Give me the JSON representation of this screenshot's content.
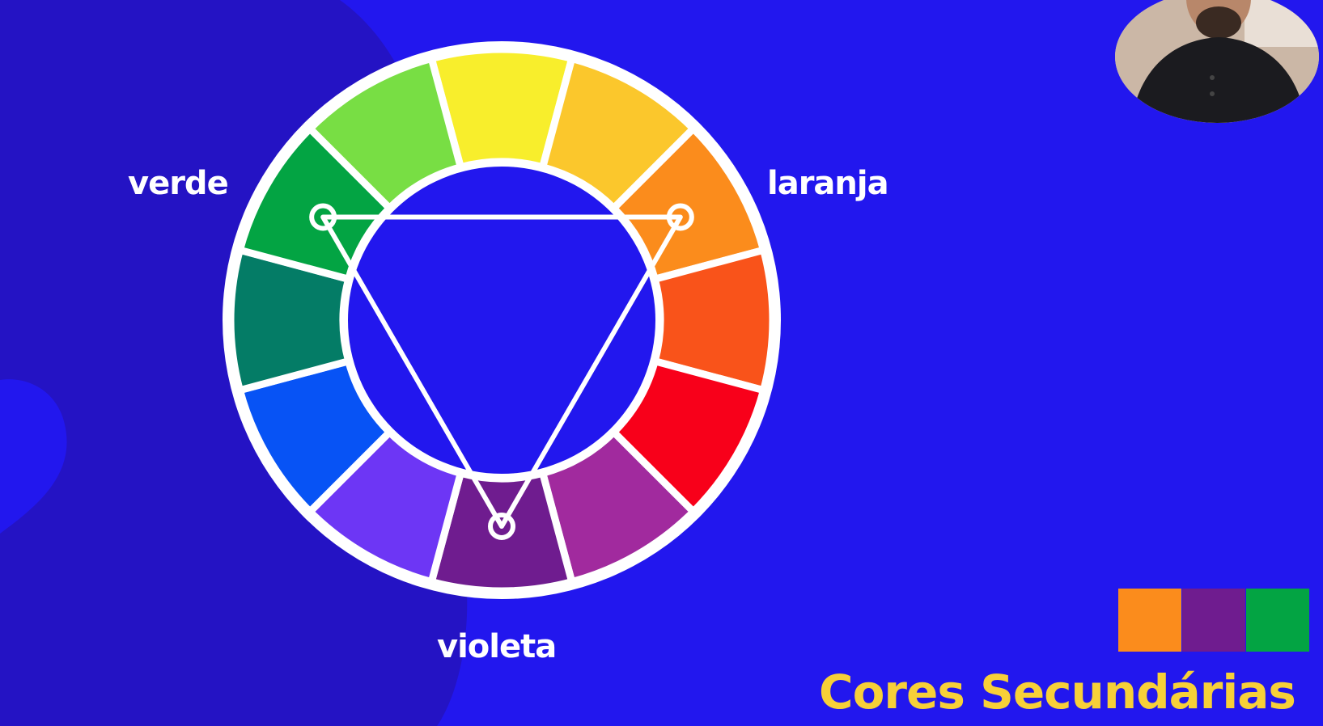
{
  "labels": {
    "verde": "verde",
    "laranja": "laranja",
    "violeta": "violeta"
  },
  "title": "Cores Secundárias",
  "colors": {
    "background": "#2217ee",
    "background_shape": "#2413c4",
    "ring_border": "#ffffff",
    "title": "#f7d038"
  },
  "wheel": {
    "segments": [
      {
        "name": "yellow",
        "color": "#f8ee2c"
      },
      {
        "name": "yellow-orange",
        "color": "#fbc72c"
      },
      {
        "name": "orange",
        "color": "#fb8c1c"
      },
      {
        "name": "red-orange",
        "color": "#f9531a"
      },
      {
        "name": "red",
        "color": "#f8001a"
      },
      {
        "name": "red-violet",
        "color": "#a12a9e"
      },
      {
        "name": "violet",
        "color": "#6f1c8f"
      },
      {
        "name": "blue-violet",
        "color": "#6d36f5"
      },
      {
        "name": "blue",
        "color": "#0753f5"
      },
      {
        "name": "blue-green",
        "color": "#047c66"
      },
      {
        "name": "green",
        "color": "#03a443"
      },
      {
        "name": "yellow-green",
        "color": "#78de44"
      }
    ],
    "triangle_vertices": [
      "green",
      "orange",
      "violet"
    ]
  },
  "swatches": [
    "#fb8c1c",
    "#6f1c8f",
    "#03a443"
  ]
}
